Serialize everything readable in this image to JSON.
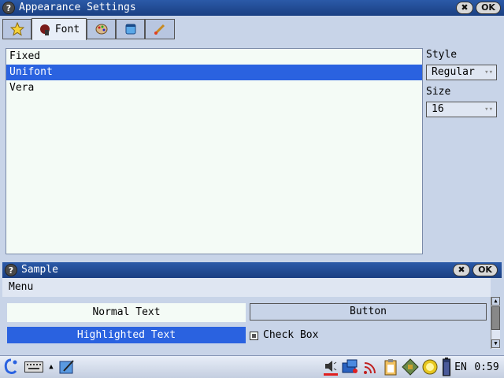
{
  "main_window": {
    "title": "Appearance Settings",
    "ok_label": "OK",
    "close_label": "✖",
    "help_label": "?"
  },
  "tabs": [
    {
      "label": "",
      "icon": "star-icon"
    },
    {
      "label": "Font",
      "icon": "font-icon",
      "active": true
    },
    {
      "label": "",
      "icon": "palette-icon"
    },
    {
      "label": "",
      "icon": "window-icon"
    },
    {
      "label": "",
      "icon": "brush-icon"
    }
  ],
  "font_list": {
    "items": [
      "Fixed",
      "Unifont",
      "Vera"
    ],
    "selected": "Unifont"
  },
  "style": {
    "label": "Style",
    "value": "Regular"
  },
  "size": {
    "label": "Size",
    "value": "16"
  },
  "sample_window": {
    "title": "Sample",
    "ok_label": "OK",
    "close_label": "✖",
    "help_label": "?",
    "menu_label": "Menu",
    "normal_text": "Normal Text",
    "button_label": "Button",
    "highlighted_text": "Highlighted Text",
    "checkbox_label": "Check Box"
  },
  "taskbar": {
    "language": "EN",
    "time": "0:59"
  },
  "colors": {
    "titlebar": "#1a3f82",
    "selection": "#2a62e0",
    "background": "#c8d4e8",
    "list_background": "#f4fbf6"
  }
}
